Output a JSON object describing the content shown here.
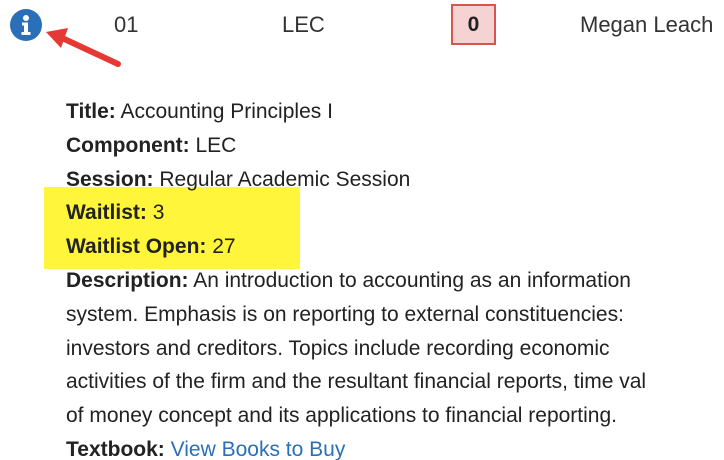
{
  "row": {
    "icon": "info-icon",
    "section": "01",
    "component": "LEC",
    "enrolled": "0",
    "instructor": "Megan Leach"
  },
  "details": {
    "title_label": "Title:",
    "title_value": " Accounting Principles I",
    "component_label": "Component:",
    "component_value": " LEC",
    "session_label": "Session:",
    "session_value": " Regular Academic Session",
    "waitlist_label": "Waitlist:",
    "waitlist_value": " 3",
    "waitlist_open_label": "Waitlist Open:",
    "waitlist_open_value": " 27",
    "description_label": "Description:",
    "description_lines": [
      " An introduction to accounting as an information",
      "system. Emphasis is on reporting to external constituencies:",
      "investors and creditors. Topics include recording economic",
      "activities of the firm and the resultant financial reports, time val",
      "of money concept and its applications to financial reporting."
    ],
    "textbook_label": "Textbook:",
    "textbook_link": "View Books to Buy"
  },
  "colors": {
    "icon": "#2a6fb8",
    "link": "#2a6fb8",
    "badge_border": "#d9534f",
    "badge_fill": "#f6d3d3",
    "highlight": "#fff53a",
    "arrow": "#e53935"
  }
}
